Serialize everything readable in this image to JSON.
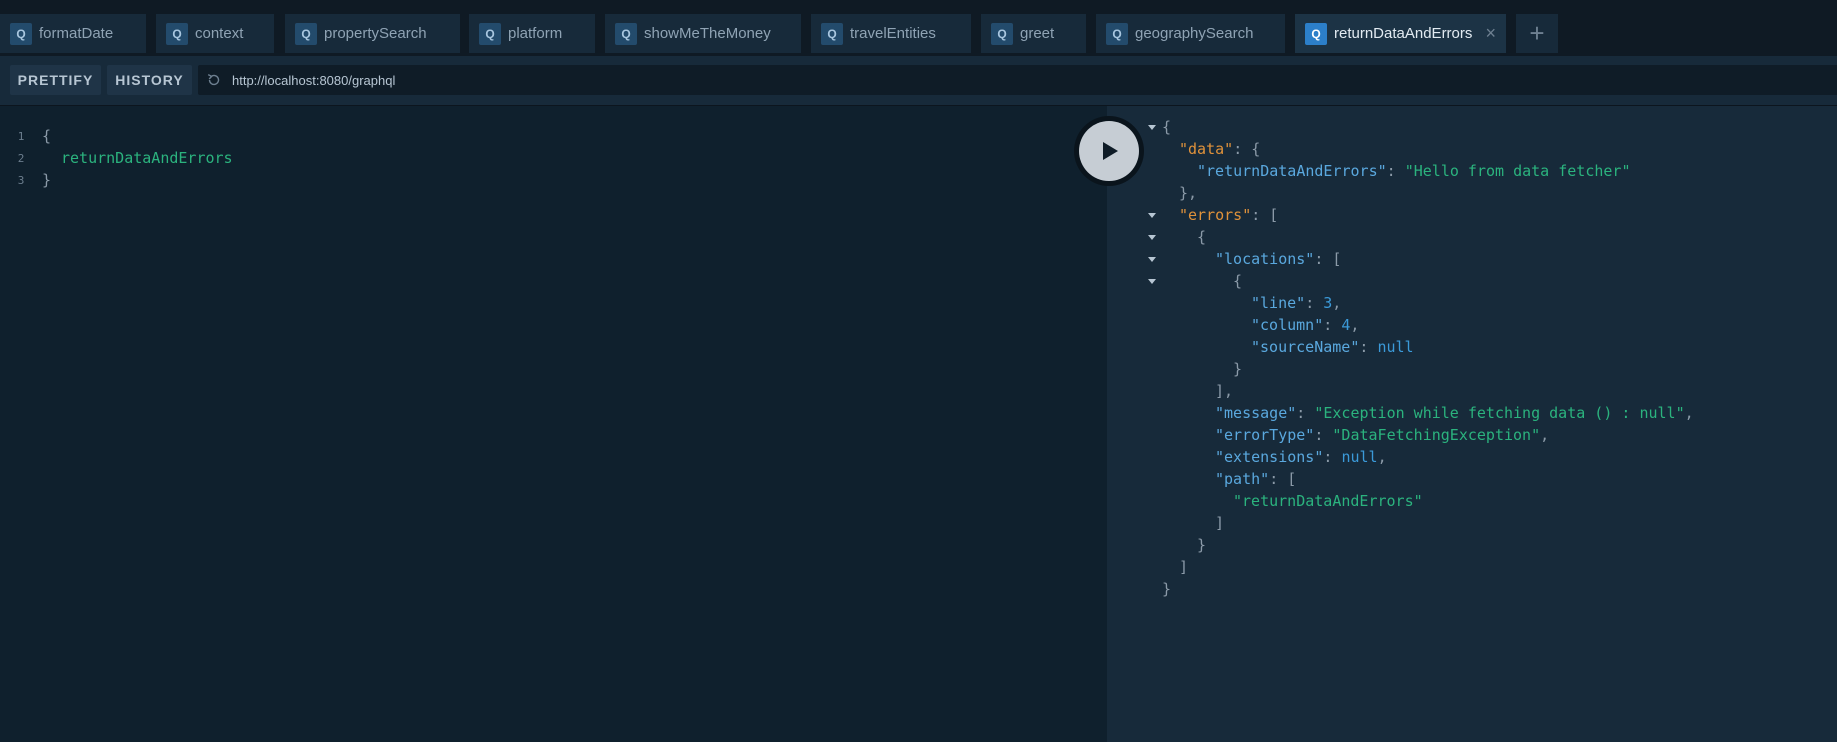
{
  "tabs": [
    {
      "label": "formatDate",
      "badge": "Q"
    },
    {
      "label": "context",
      "badge": "Q"
    },
    {
      "label": "propertySearch",
      "badge": "Q"
    },
    {
      "label": "platform",
      "badge": "Q"
    },
    {
      "label": "showMeTheMoney",
      "badge": "Q"
    },
    {
      "label": "travelEntities",
      "badge": "Q"
    },
    {
      "label": "greet",
      "badge": "Q"
    },
    {
      "label": "geographySearch",
      "badge": "Q"
    },
    {
      "label": "returnDataAndErrors",
      "badge": "Q",
      "active": true
    }
  ],
  "add_tab_label": "+",
  "close_label": "×",
  "toolbar": {
    "prettify_label": "PRETTIFY",
    "history_label": "HISTORY",
    "url": "http://localhost:8080/graphql"
  },
  "editor": {
    "line_numbers": [
      "1",
      "2",
      "3"
    ],
    "open_brace": "{",
    "field": "returnDataAndErrors",
    "close_brace": "}"
  },
  "result": {
    "data_key": "\"data\"",
    "data_field_key": "\"returnDataAndErrors\"",
    "data_field_value": "\"Hello from data fetcher\"",
    "errors_key": "\"errors\"",
    "locations_key": "\"locations\"",
    "line_key": "\"line\"",
    "line_value": "3",
    "column_key": "\"column\"",
    "column_value": "4",
    "sourceName_key": "\"sourceName\"",
    "sourceName_value": "null",
    "message_key": "\"message\"",
    "message_value": "\"Exception while fetching data () : null\"",
    "errorType_key": "\"errorType\"",
    "errorType_value": "\"DataFetchingException\"",
    "extensions_key": "\"extensions\"",
    "extensions_value": "null",
    "path_key": "\"path\"",
    "path_item": "\"returnDataAndErrors\""
  },
  "colors": {
    "string": "#2bb37e",
    "key": "#5aa8de",
    "top_key": "#e0923a",
    "number": "#3b9ad9",
    "accent": "#2c7fc9"
  }
}
